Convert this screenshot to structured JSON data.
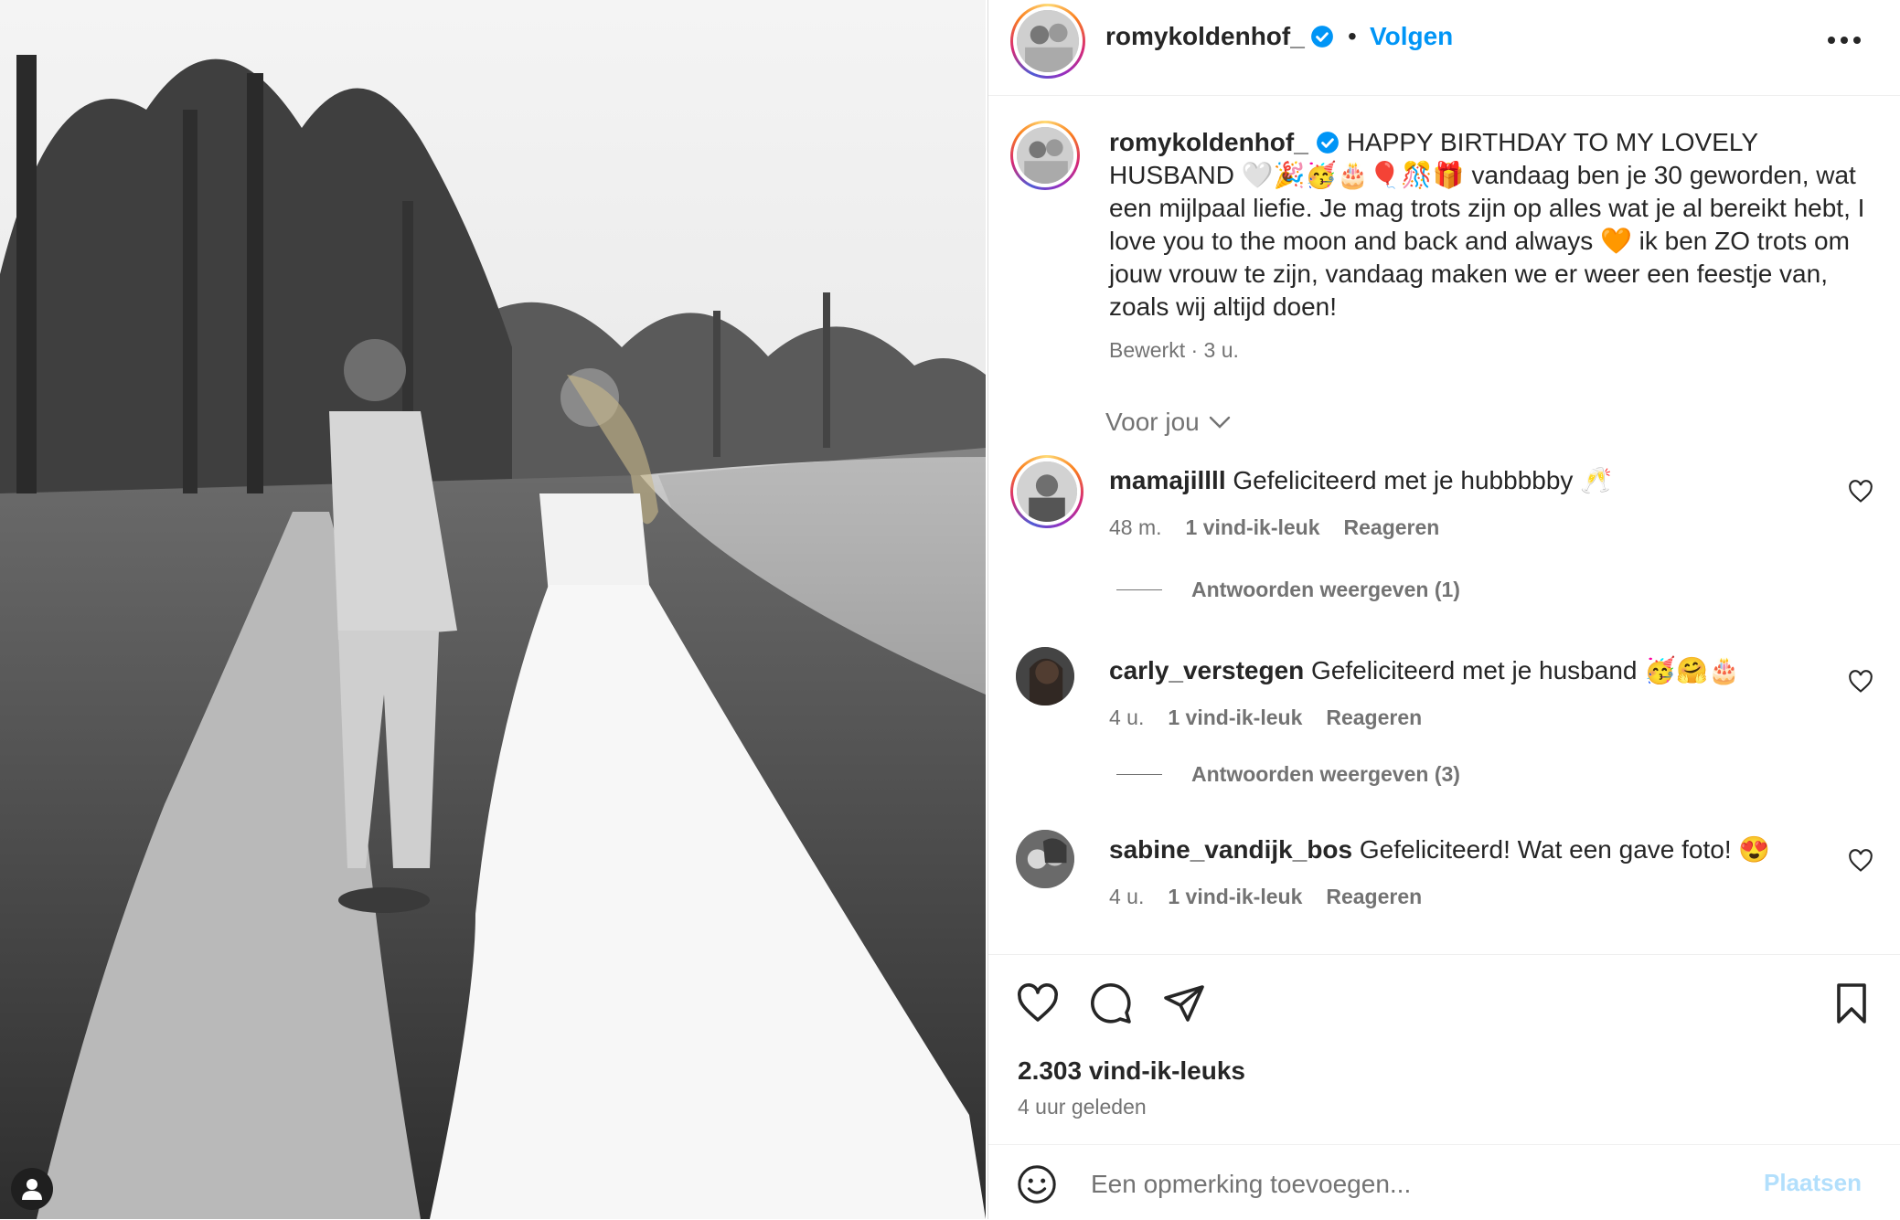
{
  "post": {
    "username": "romykoldenhof_",
    "dot": "•",
    "follow_label": "Volgen",
    "more_icon": "more-horizontal-icon",
    "verified_icon": "verified-badge-icon"
  },
  "caption": {
    "username": "romykoldenhof_",
    "text": "HAPPY BIRTHDAY TO MY LOVELY HUSBAND 🤍🎉🥳🎂🎈🎊🎁 vandaag ben je 30 geworden, wat een mijlpaal liefie. Je mag trots zijn op alles wat je al bereikt hebt, I love you to the moon and back and always 🧡 ik ben ZO trots om jouw vrouw te zijn, vandaag maken we er weer een feestje van, zoals wij altijd doen!",
    "meta": "Bewerkt · 3 u."
  },
  "for_you_label": "Voor jou",
  "comments": [
    {
      "username": "mamajillll",
      "text": "Gefeliciteerd met je hubbbbby 🥂",
      "time": "48 m.",
      "likes": "1 vind-ik-leuk",
      "reply": "Reageren",
      "view_replies": "Antwoorden weergeven (1)"
    },
    {
      "username": "carly_verstegen",
      "text": "Gefeliciteerd met je husband 🥳🤗🎂",
      "time": "4 u.",
      "likes": "1 vind-ik-leuk",
      "reply": "Reageren",
      "view_replies": "Antwoorden weergeven (3)"
    },
    {
      "username": "sabine_vandijk_bos",
      "text": "Gefeliciteerd! Wat een gave foto! 😍",
      "time": "4 u.",
      "likes": "1 vind-ik-leuk",
      "reply": "Reageren"
    }
  ],
  "stats": {
    "likes": "2.303 vind-ik-leuks",
    "time_ago": "4 uur geleden"
  },
  "comment_box": {
    "placeholder": "Een opmerking toevoegen...",
    "post_label": "Plaatsen"
  },
  "colors": {
    "accent": "#0095f6",
    "text": "#262626",
    "muted": "#737373",
    "post_disabled": "#b2dffc"
  }
}
